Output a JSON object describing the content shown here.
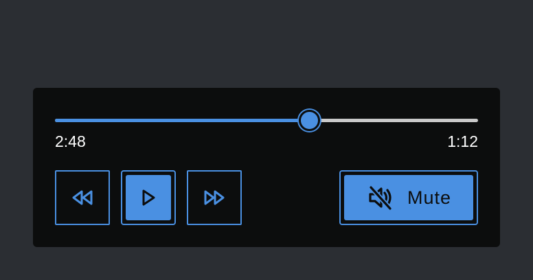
{
  "player": {
    "progress": 0.6,
    "elapsed": "2:48",
    "remaining": "1:12",
    "controls": {
      "rewind_icon": "rewind-icon",
      "play_icon": "play-icon",
      "forward_icon": "fast-forward-icon",
      "mute_icon": "speaker-muted-icon",
      "mute_label": "Mute"
    }
  },
  "colors": {
    "accent": "#4a90e2",
    "panel": "#0c0d0d",
    "page": "#2b2e33",
    "track": "#c9c9c9"
  }
}
